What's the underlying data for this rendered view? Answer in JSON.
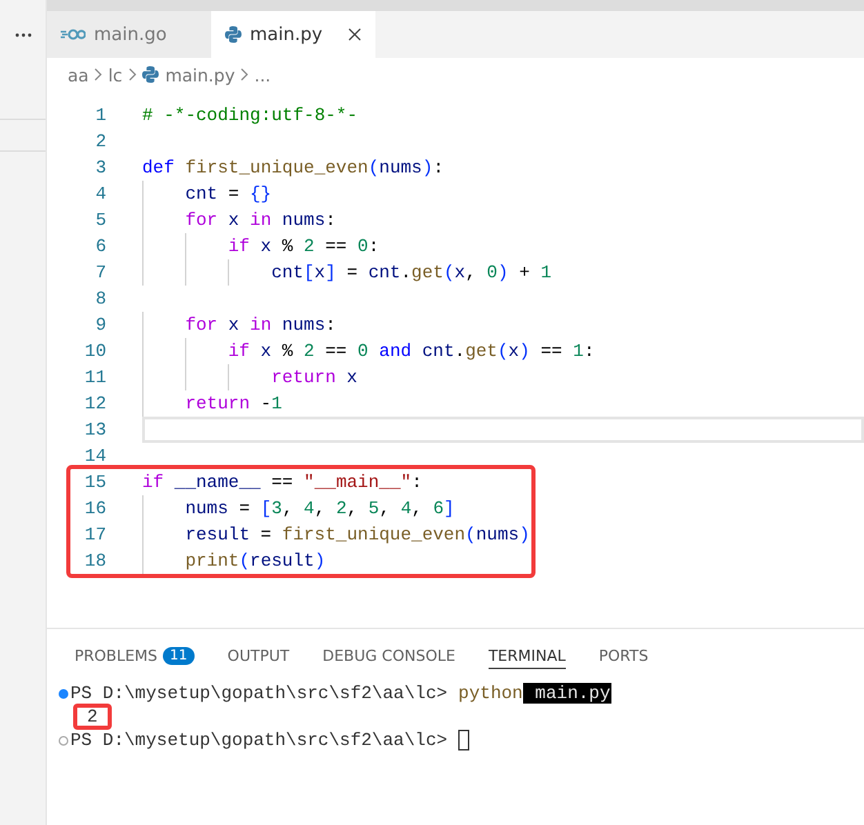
{
  "tabs": [
    {
      "label": "main.go",
      "kind": "go",
      "selected": false
    },
    {
      "label": "main.py",
      "kind": "python",
      "selected": true
    }
  ],
  "breadcrumb": [
    {
      "label": "aa",
      "kind": "folder"
    },
    {
      "label": "lc",
      "kind": "folder"
    },
    {
      "label": "main.py",
      "kind": "python"
    },
    {
      "label": "...",
      "kind": "more"
    }
  ],
  "editor": {
    "lines": [
      {
        "number": "1",
        "current": false,
        "boxed": false,
        "tokens": [
          {
            "text": "# -*-coding:utf-8-*-",
            "kind": "comment"
          }
        ]
      },
      {
        "number": "2",
        "current": false,
        "boxed": false
      },
      {
        "number": "3",
        "current": false,
        "boxed": false,
        "tokens": [
          {
            "text": "def ",
            "kind": "keyword"
          },
          {
            "text": "first_unique_even",
            "kind": "function"
          },
          {
            "text": "(",
            "kind": "bracket"
          },
          {
            "text": "nums",
            "kind": "variable"
          },
          {
            "text": ")",
            "kind": "bracket"
          },
          {
            "text": ":",
            "kind": "plain"
          }
        ]
      },
      {
        "number": "4",
        "current": false,
        "boxed": false,
        "tokens": [
          {
            "text": "    cnt",
            "kind": "variable"
          },
          {
            "text": " = ",
            "kind": "plain"
          },
          {
            "text": "{}",
            "kind": "bracket"
          }
        ]
      },
      {
        "number": "5",
        "current": false,
        "boxed": false,
        "tokens": [
          {
            "text": "    for ",
            "kind": "control"
          },
          {
            "text": "x ",
            "kind": "variable"
          },
          {
            "text": "in ",
            "kind": "control"
          },
          {
            "text": "nums",
            "kind": "variable"
          },
          {
            "text": ":",
            "kind": "plain"
          }
        ]
      },
      {
        "number": "6",
        "current": false,
        "boxed": false,
        "tokens": [
          {
            "text": "        if ",
            "kind": "control"
          },
          {
            "text": "x",
            "kind": "variable"
          },
          {
            "text": " % ",
            "kind": "plain"
          },
          {
            "text": "2",
            "kind": "number"
          },
          {
            "text": " == ",
            "kind": "plain"
          },
          {
            "text": "0",
            "kind": "number"
          },
          {
            "text": ":",
            "kind": "plain"
          }
        ]
      },
      {
        "number": "7",
        "current": false,
        "boxed": false,
        "tokens": [
          {
            "text": "            cnt",
            "kind": "variable"
          },
          {
            "text": "[",
            "kind": "bracket"
          },
          {
            "text": "x",
            "kind": "variable"
          },
          {
            "text": "]",
            "kind": "bracket"
          },
          {
            "text": " = ",
            "kind": "plain"
          },
          {
            "text": "cnt",
            "kind": "variable"
          },
          {
            "text": ".",
            "kind": "plain"
          },
          {
            "text": "get",
            "kind": "function"
          },
          {
            "text": "(",
            "kind": "bracket"
          },
          {
            "text": "x",
            "kind": "variable"
          },
          {
            "text": ", ",
            "kind": "plain"
          },
          {
            "text": "0",
            "kind": "number"
          },
          {
            "text": ")",
            "kind": "bracket"
          },
          {
            "text": " + ",
            "kind": "plain"
          },
          {
            "text": "1",
            "kind": "number"
          }
        ]
      },
      {
        "number": "8",
        "current": false,
        "boxed": false
      },
      {
        "number": "9",
        "current": false,
        "boxed": false,
        "tokens": [
          {
            "text": "    for ",
            "kind": "control"
          },
          {
            "text": "x ",
            "kind": "variable"
          },
          {
            "text": "in ",
            "kind": "control"
          },
          {
            "text": "nums",
            "kind": "variable"
          },
          {
            "text": ":",
            "kind": "plain"
          }
        ]
      },
      {
        "number": "10",
        "current": false,
        "boxed": false,
        "tokens": [
          {
            "text": "        if ",
            "kind": "control"
          },
          {
            "text": "x",
            "kind": "variable"
          },
          {
            "text": " % ",
            "kind": "plain"
          },
          {
            "text": "2",
            "kind": "number"
          },
          {
            "text": " == ",
            "kind": "plain"
          },
          {
            "text": "0 ",
            "kind": "number"
          },
          {
            "text": "and ",
            "kind": "keyword"
          },
          {
            "text": "cnt",
            "kind": "variable"
          },
          {
            "text": ".",
            "kind": "plain"
          },
          {
            "text": "get",
            "kind": "function"
          },
          {
            "text": "(",
            "kind": "bracket"
          },
          {
            "text": "x",
            "kind": "variable"
          },
          {
            "text": ")",
            "kind": "bracket"
          },
          {
            "text": " == ",
            "kind": "plain"
          },
          {
            "text": "1",
            "kind": "number"
          },
          {
            "text": ":",
            "kind": "plain"
          }
        ]
      },
      {
        "number": "11",
        "current": false,
        "boxed": false,
        "tokens": [
          {
            "text": "            return ",
            "kind": "control"
          },
          {
            "text": "x",
            "kind": "variable"
          }
        ]
      },
      {
        "number": "12",
        "current": false,
        "boxed": false,
        "tokens": [
          {
            "text": "    return",
            "kind": "control"
          },
          {
            "text": " -",
            "kind": "plain"
          },
          {
            "text": "1",
            "kind": "number"
          }
        ]
      },
      {
        "number": "13",
        "current": true,
        "boxed": false
      },
      {
        "number": "14",
        "current": false,
        "boxed": false
      },
      {
        "number": "15",
        "current": false,
        "boxed": true,
        "tokens": [
          {
            "text": "if ",
            "kind": "control"
          },
          {
            "text": "__name__",
            "kind": "variable"
          },
          {
            "text": " == ",
            "kind": "plain"
          },
          {
            "text": "\"__main__\"",
            "kind": "string"
          },
          {
            "text": ":",
            "kind": "plain"
          }
        ]
      },
      {
        "number": "16",
        "current": false,
        "boxed": true,
        "tokens": [
          {
            "text": "    nums",
            "kind": "variable"
          },
          {
            "text": " = ",
            "kind": "plain"
          },
          {
            "text": "[",
            "kind": "bracket"
          },
          {
            "text": "3",
            "kind": "number"
          },
          {
            "text": ", ",
            "kind": "plain"
          },
          {
            "text": "4",
            "kind": "number"
          },
          {
            "text": ", ",
            "kind": "plain"
          },
          {
            "text": "2",
            "kind": "number"
          },
          {
            "text": ", ",
            "kind": "plain"
          },
          {
            "text": "5",
            "kind": "number"
          },
          {
            "text": ", ",
            "kind": "plain"
          },
          {
            "text": "4",
            "kind": "number"
          },
          {
            "text": ", ",
            "kind": "plain"
          },
          {
            "text": "6",
            "kind": "number"
          },
          {
            "text": "]",
            "kind": "bracket"
          }
        ]
      },
      {
        "number": "17",
        "current": false,
        "boxed": true,
        "tokens": [
          {
            "text": "    result",
            "kind": "variable"
          },
          {
            "text": " = ",
            "kind": "plain"
          },
          {
            "text": "first_unique_even",
            "kind": "function"
          },
          {
            "text": "(",
            "kind": "bracket"
          },
          {
            "text": "nums",
            "kind": "variable"
          },
          {
            "text": ")",
            "kind": "bracket"
          }
        ]
      },
      {
        "number": "18",
        "current": false,
        "boxed": true,
        "tokens": [
          {
            "text": "    print",
            "kind": "function"
          },
          {
            "text": "(",
            "kind": "bracket"
          },
          {
            "text": "result",
            "kind": "variable"
          },
          {
            "text": ")",
            "kind": "bracket"
          }
        ]
      }
    ]
  },
  "panel": {
    "tabs": [
      {
        "label": "PROBLEMS",
        "badge": "11",
        "selected": false
      },
      {
        "label": "OUTPUT",
        "selected": false
      },
      {
        "label": "DEBUG CONSOLE",
        "selected": false
      },
      {
        "label": "TERMINAL",
        "selected": true
      },
      {
        "label": "PORTS",
        "selected": false
      }
    ],
    "terminal": [
      {
        "kind": "prompt",
        "filled": true,
        "prompt": "PS D:\\mysetup\\gopath\\src\\sf2\\aa\\lc>",
        "command": "python",
        "argument": "main.py",
        "cursor": false
      },
      {
        "kind": "output",
        "text": "2",
        "boxed": true
      },
      {
        "kind": "prompt",
        "filled": false,
        "prompt": "PS D:\\mysetup\\gopath\\src\\sf2\\aa\\lc>",
        "cursor": true
      }
    ]
  }
}
